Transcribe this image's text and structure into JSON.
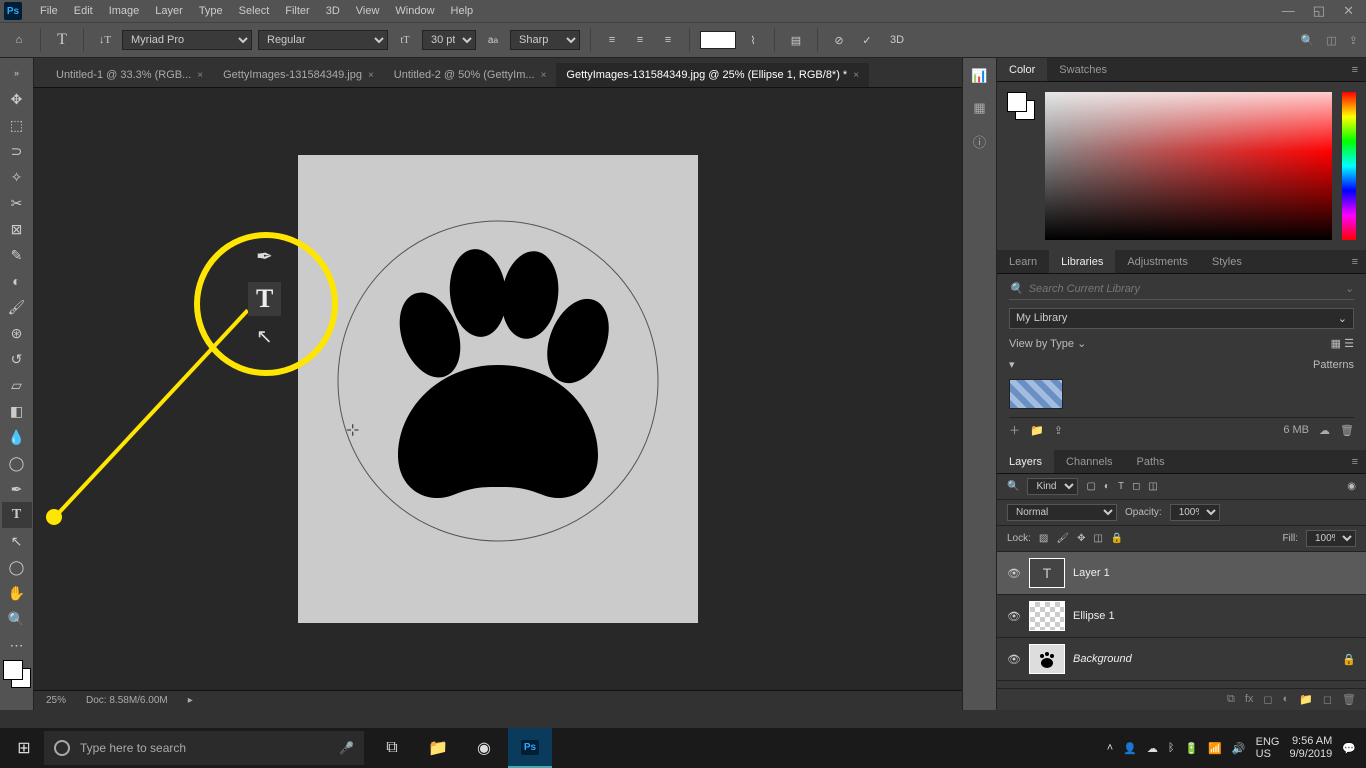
{
  "menu": {
    "items": [
      "File",
      "Edit",
      "Image",
      "Layer",
      "Type",
      "Select",
      "Filter",
      "3D",
      "View",
      "Window",
      "Help"
    ]
  },
  "optbar": {
    "font": "Myriad Pro",
    "style": "Regular",
    "size": "30 pt",
    "aa": "Sharp",
    "threeD": "3D"
  },
  "tabs": [
    {
      "label": "Untitled-1 @ 33.3% (RGB..."
    },
    {
      "label": "GettyImages-131584349.jpg"
    },
    {
      "label": "Untitled-2 @ 50% (GettyIm..."
    },
    {
      "label": "GettyImages-131584349.jpg @ 25% (Ellipse 1, RGB/8*) *",
      "active": true
    }
  ],
  "status": {
    "zoom": "25%",
    "docinfo": "Doc: 8.58M/6.00M"
  },
  "colorPanel": {
    "tabs": [
      "Color",
      "Swatches"
    ]
  },
  "libPanel": {
    "tabs": [
      "Learn",
      "Libraries",
      "Adjustments",
      "Styles"
    ],
    "searchPlaceholder": "Search Current Library",
    "library": "My Library",
    "viewBy": "View by Type",
    "section": "Patterns",
    "size": "6 MB"
  },
  "layerPanel": {
    "tabs": [
      "Layers",
      "Channels",
      "Paths"
    ],
    "kind": "Kind",
    "blend": "Normal",
    "opacityLabel": "Opacity:",
    "opacity": "100%",
    "lockLabel": "Lock:",
    "fillLabel": "Fill:",
    "fill": "100%",
    "layers": [
      {
        "name": "Layer 1",
        "sel": true,
        "thumb": "T"
      },
      {
        "name": "Ellipse 1",
        "thumb": "chk"
      },
      {
        "name": "Background",
        "thumb": "bg",
        "locked": true,
        "italic": true
      }
    ]
  },
  "taskbar": {
    "searchPlaceholder": "Type here to search",
    "lang": "ENG",
    "locale": "US",
    "time": "9:56 AM",
    "date": "9/9/2019"
  }
}
